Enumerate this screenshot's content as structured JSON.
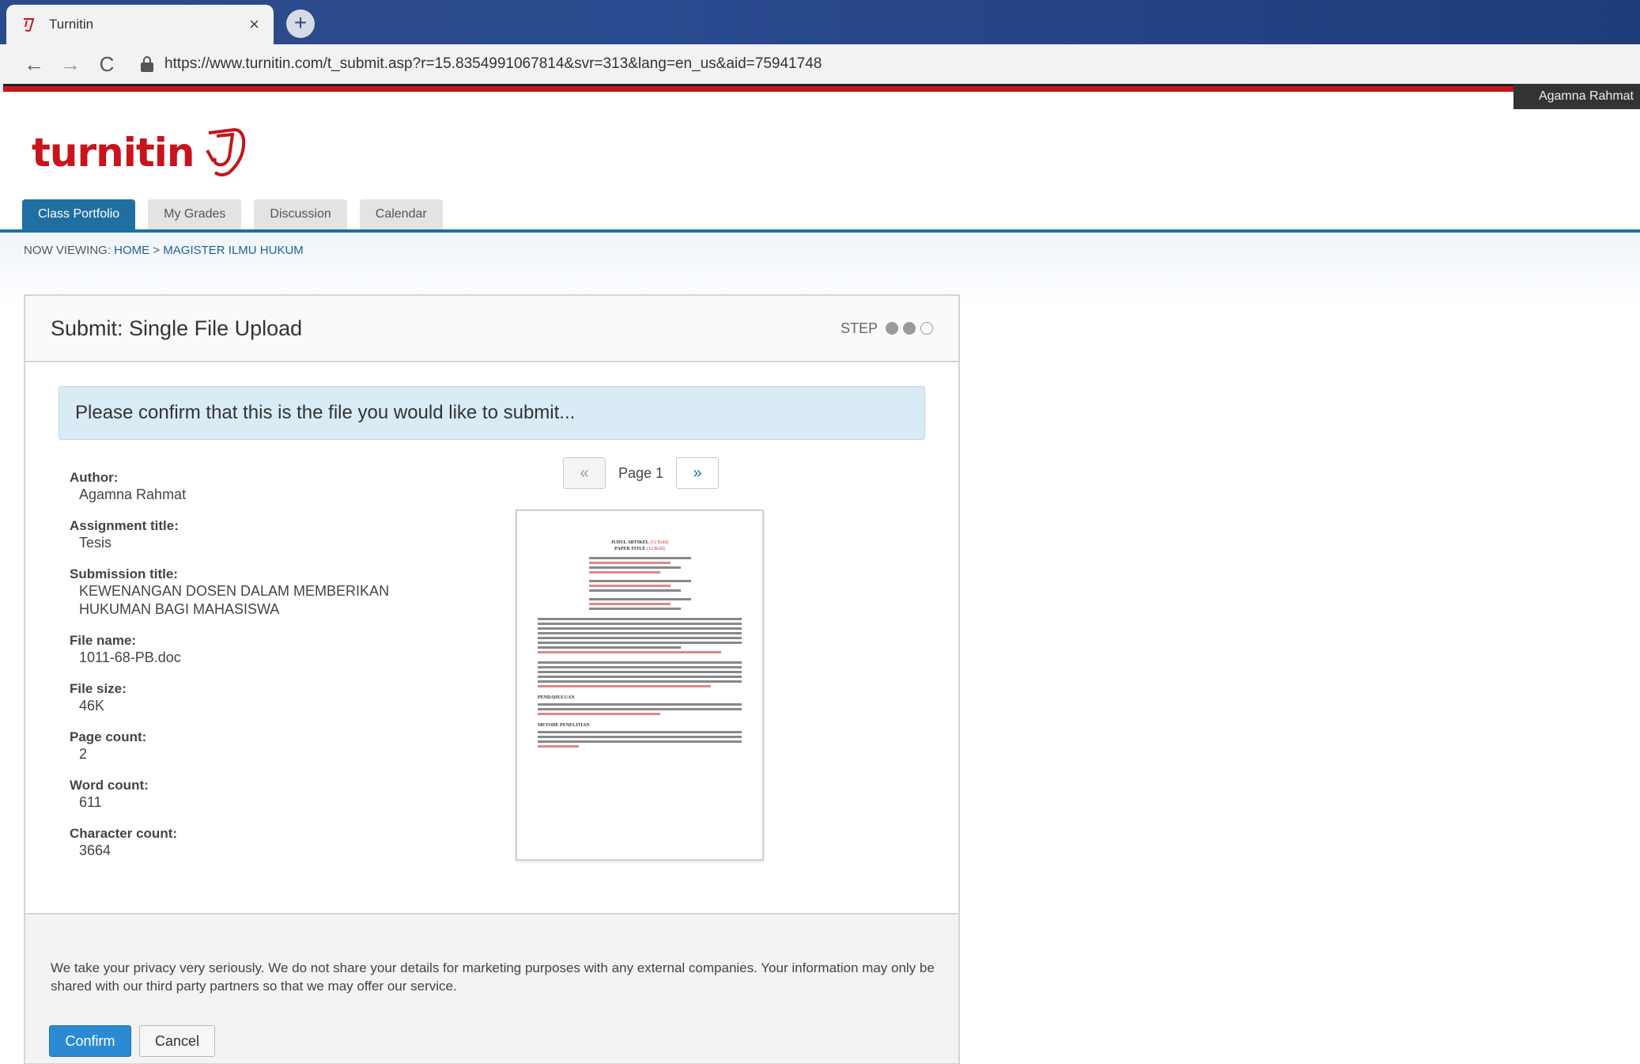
{
  "browser": {
    "tab_title": "Turnitin",
    "close_glyph": "×",
    "newtab_glyph": "+",
    "back_glyph": "←",
    "forward_glyph": "→",
    "reload_glyph": "C",
    "url": "https://www.turnitin.com/t_submit.asp?r=15.8354991067814&svr=313&lang=en_us&aid=75941748"
  },
  "user": {
    "name": "Agamna Rahmat"
  },
  "brand": {
    "logo_text": "turnitin",
    "color": "#c8141b"
  },
  "nav": {
    "tabs": [
      {
        "label": "Class Portfolio",
        "active": true
      },
      {
        "label": "My Grades",
        "active": false
      },
      {
        "label": "Discussion",
        "active": false
      },
      {
        "label": "Calendar",
        "active": false
      }
    ]
  },
  "breadcrumb": {
    "prefix": "NOW VIEWING:",
    "home": "HOME",
    "separator": ">",
    "current": "MAGISTER ILMU HUKUM"
  },
  "panel": {
    "title": "Submit: Single File Upload",
    "step_label": "STEP",
    "step_current": 2,
    "step_total": 3,
    "confirm_message": "Please confirm that this is the file you would like to submit..."
  },
  "meta": [
    {
      "label": "Author:",
      "value": "Agamna Rahmat"
    },
    {
      "label": "Assignment title:",
      "value": "Tesis"
    },
    {
      "label": "Submission title:",
      "value": "KEWENANGAN DOSEN DALAM MEMBERIKAN HUKUMAN BAGI MAHASISWA"
    },
    {
      "label": "File name:",
      "value": "1011-68-PB.doc"
    },
    {
      "label": "File size:",
      "value": "46K"
    },
    {
      "label": "Page count:",
      "value": "2"
    },
    {
      "label": "Word count:",
      "value": "611"
    },
    {
      "label": "Character count:",
      "value": "3664"
    }
  ],
  "pager": {
    "prev_glyph": "«",
    "label": "Page 1",
    "next_glyph": "»"
  },
  "preview": {
    "title_line": "JUDUL ARTIKEL",
    "paper_title": "PAPER TITLE",
    "section1": "PENDAHULUAN",
    "section2": "METODE PENELITIAN"
  },
  "footer": {
    "privacy": "We take your privacy very seriously. We do not share your details for marketing purposes with any external companies. Your information may only be shared with our third party partners so that we may offer our service.",
    "confirm_label": "Confirm",
    "cancel_label": "Cancel"
  },
  "colors": {
    "accent": "#1f6fa3",
    "primary_button": "#2a8ad4",
    "notice_bg": "#d9ebf5"
  }
}
